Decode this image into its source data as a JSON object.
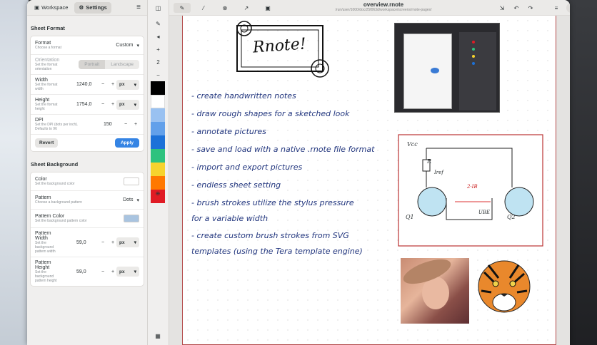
{
  "sidebar": {
    "tabs": [
      {
        "label": "Workspace",
        "icon": "folder-icon"
      },
      {
        "label": "Settings",
        "icon": "gear-icon"
      }
    ],
    "menu_icon": "hamburger-menu-icon",
    "sheet_format": {
      "heading": "Sheet Format",
      "format": {
        "label": "Format",
        "sub": "Choose a format",
        "value": "Custom"
      },
      "orientation": {
        "label": "Orientation",
        "sub": "Set the format orientation",
        "options": [
          "Portrait",
          "Landscape"
        ]
      },
      "width": {
        "label": "Width",
        "sub": "Set the format width",
        "value": "1240,0",
        "unit": "px"
      },
      "height": {
        "label": "Height",
        "sub": "Set the format height",
        "value": "1754,0",
        "unit": "px"
      },
      "dpi": {
        "label": "DPI",
        "sub": "Set the DPI (dots per inch). Defaults to 96",
        "value": "150"
      },
      "revert": "Revert",
      "apply": "Apply"
    },
    "sheet_background": {
      "heading": "Sheet Background",
      "color": {
        "label": "Color",
        "sub": "Set the background color",
        "swatch": "#ffffff"
      },
      "pattern": {
        "label": "Pattern",
        "sub": "Choose a background pattern",
        "value": "Dots"
      },
      "pattern_color": {
        "label": "Pattern Color",
        "sub": "Set the background pattern color",
        "swatch": "#a9c4e0"
      },
      "pattern_width": {
        "label": "Pattern Width",
        "sub": "Set the background pattern width",
        "value": "59,0",
        "unit": "px"
      },
      "pattern_height": {
        "label": "Pattern Height",
        "sub": "Set the background pattern height",
        "value": "59,0",
        "unit": "px"
      }
    }
  },
  "toolbar": {
    "zoom": "2",
    "palette": [
      "#000000",
      "#ffffff",
      "#99c1f1",
      "#62a0ea",
      "#1c71d8",
      "#2ec27e",
      "#f6d32d",
      "#ff7800",
      "#e01b24"
    ]
  },
  "header": {
    "title": "overview.rnote",
    "path": "/run/user/1000/doc/25f063d/workspace/screens/rnote-pages/",
    "tools": [
      "pen-icon",
      "shaper-icon",
      "eraser-icon",
      "selector-icon",
      "typewriter-icon"
    ]
  },
  "notes": {
    "logo": "Rnote!",
    "lines": [
      "- create handwritten notes",
      "- draw rough shapes for a sketched look",
      "- annotate pictures",
      "- save and load with a native .rnote file format",
      "- import and export pictures",
      "- endless sheet setting",
      "- brush strokes utilize the stylus pressure",
      "  for a variable width",
      "- create custom brush strokes from SVG",
      "  templates (using the Tera template engine)"
    ],
    "circuit": {
      "vcc": "Vcc",
      "r": "R",
      "iref": "Iref",
      "i2": "2·IB",
      "q1": "Q1",
      "q2": "Q2",
      "ube": "UBE"
    }
  },
  "colors": {
    "accent": "#3584e4",
    "ink": "#22367e",
    "sheet_border": "#b34a4a"
  }
}
